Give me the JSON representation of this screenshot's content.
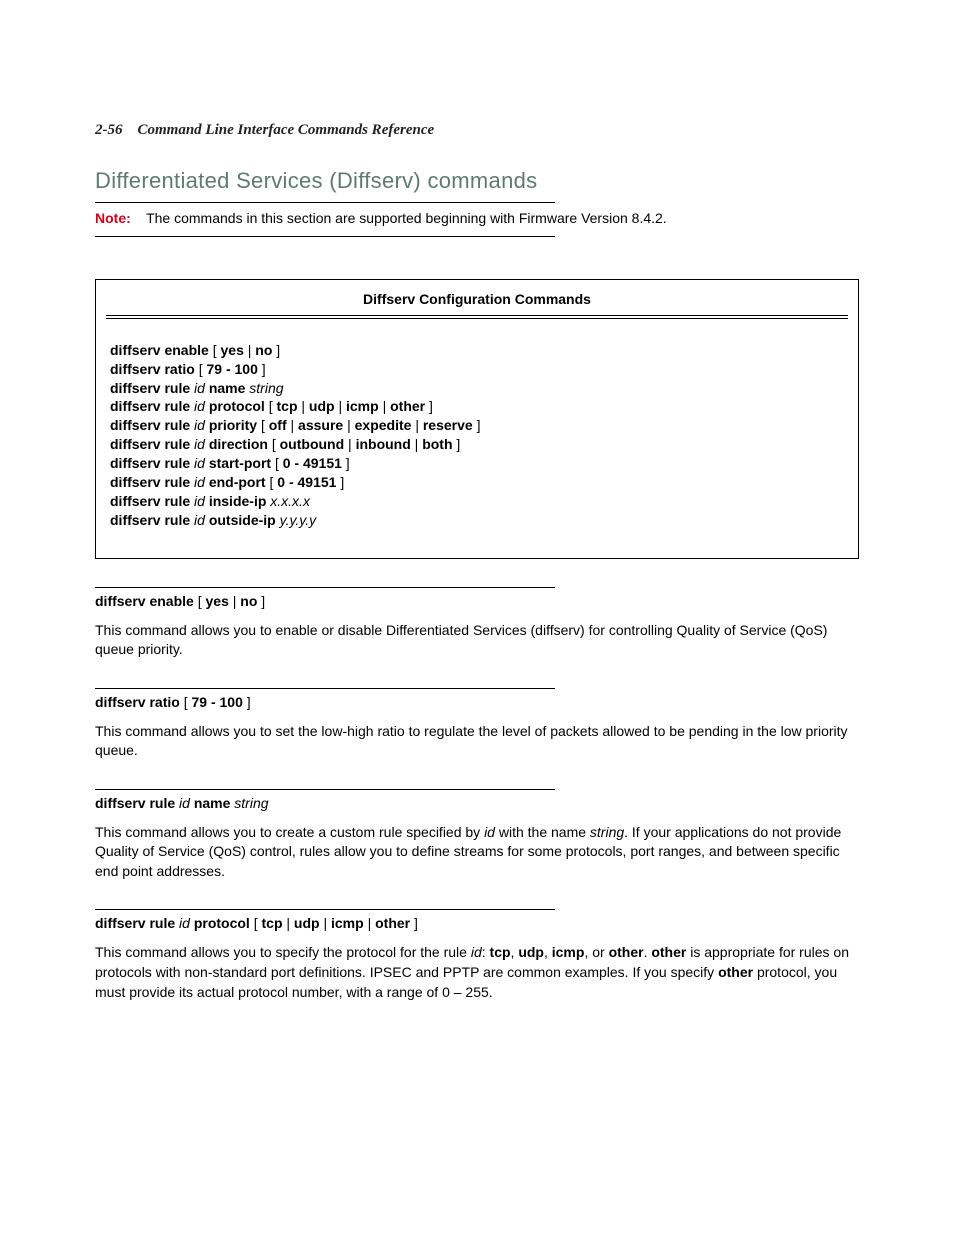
{
  "header": {
    "page_num": "2-56",
    "title": "Command Line Interface Commands Reference"
  },
  "section_title": "Differentiated Services (Diffserv) commands",
  "note": {
    "label": "Note:",
    "text": "The commands in this section are supported beginning with Firmware Version 8.4.2."
  },
  "table": {
    "title": "Diffserv Configuration Commands",
    "lines": [
      [
        {
          "t": "diffserv enable",
          "b": 1
        },
        {
          "t": " [ "
        },
        {
          "t": "yes",
          "b": 1
        },
        {
          "t": " | "
        },
        {
          "t": "no",
          "b": 1
        },
        {
          "t": " ]"
        }
      ],
      [
        {
          "t": "diffserv ratio",
          "b": 1
        },
        {
          "t": " [ "
        },
        {
          "t": "79 - 100",
          "b": 1
        },
        {
          "t": " ]"
        }
      ],
      [
        {
          "t": "diffserv rule",
          "b": 1
        },
        {
          "t": " "
        },
        {
          "t": "id",
          "i": 1
        },
        {
          "t": " "
        },
        {
          "t": "name",
          "b": 1
        },
        {
          "t": " "
        },
        {
          "t": "string",
          "i": 1
        }
      ],
      [
        {
          "t": "diffserv rule",
          "b": 1
        },
        {
          "t": " "
        },
        {
          "t": "id",
          "i": 1
        },
        {
          "t": " "
        },
        {
          "t": "protocol",
          "b": 1
        },
        {
          "t": " [ "
        },
        {
          "t": "tcp",
          "b": 1
        },
        {
          "t": " | "
        },
        {
          "t": "udp",
          "b": 1
        },
        {
          "t": " | "
        },
        {
          "t": "icmp",
          "b": 1
        },
        {
          "t": " | "
        },
        {
          "t": "other",
          "b": 1
        },
        {
          "t": " ]"
        }
      ],
      [
        {
          "t": "diffserv rule",
          "b": 1
        },
        {
          "t": " "
        },
        {
          "t": "id",
          "i": 1
        },
        {
          "t": " "
        },
        {
          "t": "priority",
          "b": 1
        },
        {
          "t": " [ "
        },
        {
          "t": "off",
          "b": 1
        },
        {
          "t": " | "
        },
        {
          "t": "assure",
          "b": 1
        },
        {
          "t": " | "
        },
        {
          "t": "expedite",
          "b": 1
        },
        {
          "t": " | "
        },
        {
          "t": "reserve",
          "b": 1
        },
        {
          "t": " ]"
        }
      ],
      [
        {
          "t": "diffserv rule",
          "b": 1
        },
        {
          "t": " "
        },
        {
          "t": "id",
          "i": 1
        },
        {
          "t": " "
        },
        {
          "t": "direction",
          "b": 1
        },
        {
          "t": " [ "
        },
        {
          "t": "outbound",
          "b": 1
        },
        {
          "t": " | "
        },
        {
          "t": "inbound",
          "b": 1
        },
        {
          "t": " | "
        },
        {
          "t": "both",
          "b": 1
        },
        {
          "t": " ]"
        }
      ],
      [
        {
          "t": "diffserv rule",
          "b": 1
        },
        {
          "t": " "
        },
        {
          "t": "id",
          "i": 1
        },
        {
          "t": " "
        },
        {
          "t": "start-port",
          "b": 1
        },
        {
          "t": " [ "
        },
        {
          "t": "0 - 49151",
          "b": 1
        },
        {
          "t": " ]"
        }
      ],
      [
        {
          "t": "diffserv rule",
          "b": 1
        },
        {
          "t": " "
        },
        {
          "t": "id",
          "i": 1
        },
        {
          "t": " "
        },
        {
          "t": "end-port",
          "b": 1
        },
        {
          "t": " [ "
        },
        {
          "t": "0 - 49151",
          "b": 1
        },
        {
          "t": " ]"
        }
      ],
      [
        {
          "t": "diffserv rule",
          "b": 1
        },
        {
          "t": " "
        },
        {
          "t": "id",
          "i": 1
        },
        {
          "t": " "
        },
        {
          "t": "inside-ip",
          "b": 1
        },
        {
          "t": " "
        },
        {
          "t": "x.x.x.x",
          "i": 1
        }
      ],
      [
        {
          "t": "diffserv rule",
          "b": 1
        },
        {
          "t": " "
        },
        {
          "t": "id",
          "i": 1
        },
        {
          "t": " "
        },
        {
          "t": "outside-ip",
          "b": 1
        },
        {
          "t": " "
        },
        {
          "t": "y.y.y.y",
          "i": 1
        }
      ]
    ]
  },
  "commands": [
    {
      "heading": [
        {
          "t": "diffserv enable",
          "b": 1
        },
        {
          "t": " [ "
        },
        {
          "t": "yes",
          "b": 1
        },
        {
          "t": " | "
        },
        {
          "t": "no",
          "b": 1
        },
        {
          "t": " ]"
        }
      ],
      "desc": [
        {
          "t": "This command allows you to enable or disable Differentiated Services (diffserv) for controlling Quality of Service (QoS) queue priority."
        }
      ]
    },
    {
      "heading": [
        {
          "t": "diffserv ratio",
          "b": 1
        },
        {
          "t": " [ "
        },
        {
          "t": "79 - 100",
          "b": 1
        },
        {
          "t": " ]"
        }
      ],
      "desc": [
        {
          "t": "This command allows you to set the low-high ratio to regulate the level of packets allowed to be pending in the low priority queue."
        }
      ]
    },
    {
      "heading": [
        {
          "t": "diffserv rule",
          "b": 1
        },
        {
          "t": " "
        },
        {
          "t": "id",
          "i": 1
        },
        {
          "t": " "
        },
        {
          "t": "name",
          "b": 1
        },
        {
          "t": " "
        },
        {
          "t": "string",
          "i": 1
        }
      ],
      "desc": [
        {
          "t": "This command allows you to create a custom rule specified by "
        },
        {
          "t": "id",
          "i": 1
        },
        {
          "t": " with the name "
        },
        {
          "t": "string",
          "i": 1
        },
        {
          "t": ". If your applications do not provide Quality of Service (QoS) control, rules allow you to define streams for some protocols, port ranges, and between specific end point addresses."
        }
      ]
    },
    {
      "heading": [
        {
          "t": "diffserv rule",
          "b": 1
        },
        {
          "t": " "
        },
        {
          "t": "id",
          "i": 1
        },
        {
          "t": " "
        },
        {
          "t": "protocol",
          "b": 1
        },
        {
          "t": " [ "
        },
        {
          "t": "tcp",
          "b": 1
        },
        {
          "t": " | "
        },
        {
          "t": "udp",
          "b": 1
        },
        {
          "t": " | "
        },
        {
          "t": "icmp",
          "b": 1
        },
        {
          "t": " | "
        },
        {
          "t": "other",
          "b": 1
        },
        {
          "t": " ]"
        }
      ],
      "desc": [
        {
          "t": "This command allows you to specify the protocol for the rule "
        },
        {
          "t": "id",
          "i": 1
        },
        {
          "t": ": "
        },
        {
          "t": "tcp",
          "b": 1
        },
        {
          "t": ", "
        },
        {
          "t": "udp",
          "b": 1
        },
        {
          "t": ", "
        },
        {
          "t": "icmp",
          "b": 1
        },
        {
          "t": ", or "
        },
        {
          "t": "other",
          "b": 1
        },
        {
          "t": ". "
        },
        {
          "t": "other",
          "b": 1
        },
        {
          "t": " is appropriate for rules on protocols with non-standard port definitions. IPSEC and PPTP are common examples. If you specify "
        },
        {
          "t": "other",
          "b": 1
        },
        {
          "t": " protocol, you must provide its actual protocol number, with a range of 0 – 255."
        }
      ]
    }
  ]
}
